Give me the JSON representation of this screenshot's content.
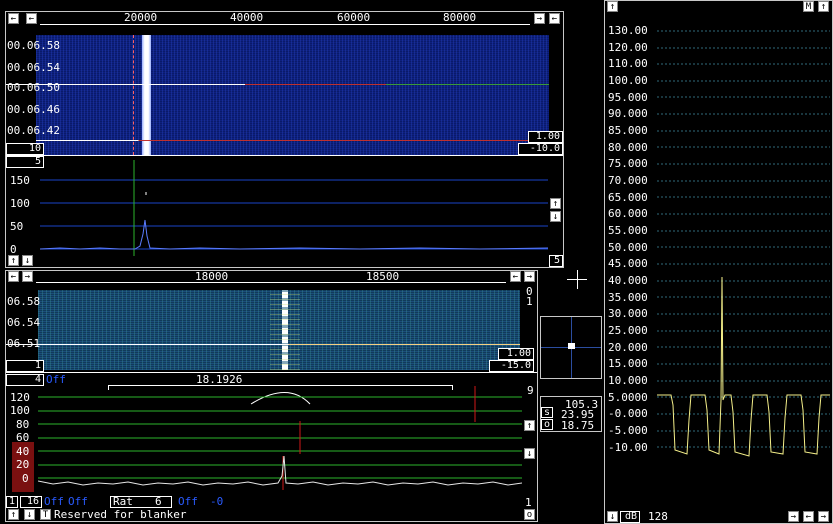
{
  "main_fft": {
    "freq_ticks": [
      "20000",
      "40000",
      "60000",
      "80000"
    ],
    "time_ticks": [
      "00.06.58",
      "00.06.54",
      "00.06.50",
      "00.06.46",
      "00.06.42"
    ],
    "wf_gain": "1.00",
    "wf_offset": "-10.0",
    "avg_left": "10",
    "spec_left_top": "5",
    "spec_ticks": [
      "150",
      "100",
      "50",
      "0"
    ],
    "spec_right_bottom": "5"
  },
  "baseband": {
    "freq_ticks": [
      "18000",
      "18500"
    ],
    "time_ticks": [
      "06.58",
      "06.54",
      "06.51"
    ],
    "right_top_a": "0",
    "right_top_b": "1",
    "wf_gain": "1.00",
    "wf_offset": "-15.0",
    "left_value": "1",
    "left_box": "4",
    "left_box_label": "Off",
    "center_freq": "18.1926",
    "spec_ticks": [
      "120",
      "100",
      "80",
      "60",
      "40",
      "20",
      "0"
    ],
    "right_value_top": "9",
    "right_value_bottom": "1",
    "bottom_row": {
      "v1": "1",
      "v2": "16",
      "tag1": "Off",
      "tag2": "Off",
      "rat_label": "Rat",
      "rat_value": "6",
      "tag3": "Off",
      "tag4": "-0",
      "reserved": "Reserved for blanker",
      "letter_t": "T",
      "letter_o": "o"
    }
  },
  "meter": {
    "s_value": "105.3",
    "mid_value": "23.95",
    "o_value": "18.75",
    "s_label": "s",
    "o_label": "o"
  },
  "right_graph": {
    "header_m": "M",
    "y_ticks": [
      "130.00",
      "120.00",
      "110.00",
      "100.00",
      "95.000",
      "90.000",
      "85.000",
      "80.000",
      "75.000",
      "70.000",
      "65.000",
      "60.000",
      "55.000",
      "50.000",
      "45.000",
      "40.000",
      "35.000",
      "30.000",
      "25.000",
      "20.000",
      "15.000",
      "10.000",
      "5.0000",
      "-0.000",
      "-5.000",
      "-10.00"
    ],
    "footer_unit": "dB",
    "footer_value": "128"
  },
  "colors": {
    "accent_blue": "#2a5bff",
    "grid_green": "#2db52d",
    "grid_blue": "#1a44c8",
    "trace_yellow": "#f5f08a",
    "marker_red": "#d01818"
  }
}
